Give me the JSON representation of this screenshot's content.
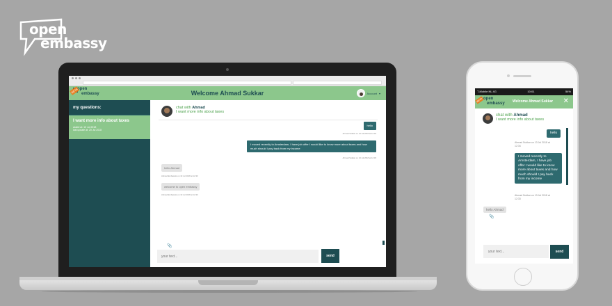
{
  "brand": {
    "line1": "open",
    "line2": "embassy",
    "color": "#ffffff"
  },
  "colors": {
    "accent_green": "#8cc78c",
    "dark_teal": "#1e4d52",
    "message_teal": "#2e6a6f",
    "background": "#a6a6a6"
  },
  "desktop": {
    "header": {
      "logo_line1": "open",
      "logo_line2": "embassy",
      "beta": "BETA",
      "title": "Welcome Ahmad Sukkar",
      "account_label": "Account",
      "caret": "▾"
    },
    "sidebar": {
      "title": "my questions:",
      "items": [
        {
          "question": "I want more info about taxes",
          "asked": "asked at: 10 Jul 2018",
          "updated": "last update at: 20 Jul 2018"
        }
      ]
    },
    "chat": {
      "with_prefix": "chat with",
      "with_name": "Ahmad",
      "topic": "I want more info about taxes",
      "messages": [
        {
          "dir": "out",
          "text": "hello",
          "meta": "Ahmad Sukkar   on 13 Jul 2018 at 12:34"
        },
        {
          "dir": "out",
          "text": "I moved recently to Amsterdam, I have job offer I would like to know more about taxes and how much should I pay back from my income",
          "meta": "Ahmad Sukkar   on 13 Jul 2018 at 12:33"
        },
        {
          "dir": "in",
          "text": "hello Ahmad",
          "meta": "Ahmad Embassist   on 13 Jul 2018 at 12:33"
        },
        {
          "dir": "in",
          "text": "welcome to open embassy",
          "meta": "Ahmad Embassist   on 13 Jul 2018 at 12:33"
        }
      ],
      "attach_icon": "paperclip-icon",
      "input_placeholder": "your text...",
      "send_label": "send"
    }
  },
  "mobile": {
    "status": {
      "carrier": "T-Mobile NL  4G",
      "time": "10:01",
      "battery": "54%"
    },
    "header": {
      "logo_line1": "open",
      "logo_line2": "embassy",
      "beta": "BETA",
      "title": "Welcome Ahmad Sukkar",
      "close": "✕"
    },
    "chat": {
      "with_prefix": "chat with",
      "with_name": "Ahmad",
      "topic": "I want more info about taxes",
      "msg1": "hello",
      "meta1a": "Ahmad Sukkar  on 13 Jul 2018 at",
      "meta1b": "12:34",
      "msg2": "I moved recently to Amsterdam, I have job offer I would like to know more about taxes and how much should I pay back from my income",
      "meta2a": "Ahmad Sukkar  on 13 Jul 2018 at",
      "meta2b": "12:33",
      "msg3": "hello Ahmad",
      "input_placeholder": "your text...",
      "send_label": "send"
    }
  }
}
